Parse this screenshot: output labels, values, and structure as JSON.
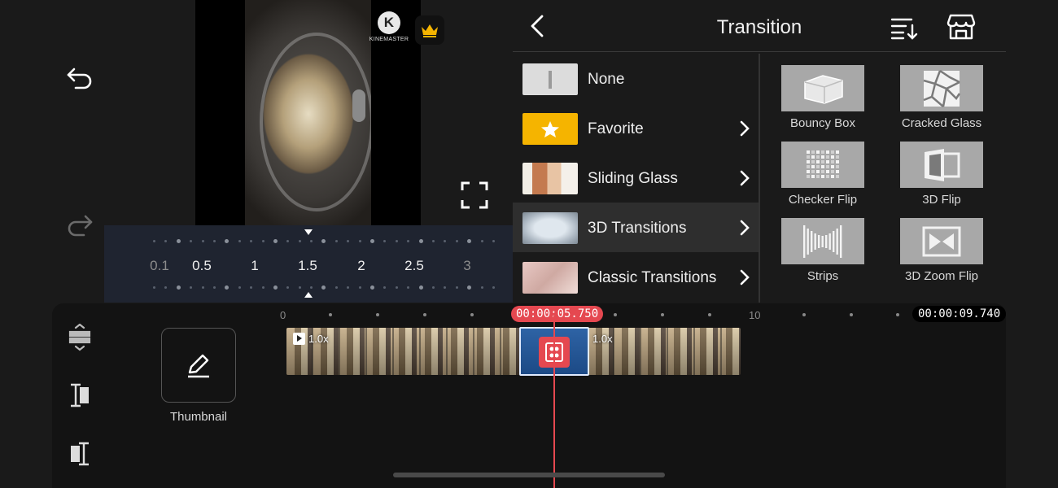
{
  "preview": {
    "watermark_text": "KINEMASTER",
    "watermark_letter": "K"
  },
  "speed": {
    "labels": [
      "0.1",
      "0.5",
      "1",
      "1.5",
      "2",
      "2.5",
      "3"
    ],
    "selected": "1.5"
  },
  "panel": {
    "title": "Transition",
    "categories": [
      {
        "label": "None",
        "has_arrow": false
      },
      {
        "label": "Favorite",
        "has_arrow": true
      },
      {
        "label": "Sliding Glass",
        "has_arrow": true
      },
      {
        "label": "3D Transitions",
        "has_arrow": true,
        "selected": true
      },
      {
        "label": "Classic Transitions",
        "has_arrow": true
      }
    ],
    "effects": [
      {
        "label": "Bouncy Box",
        "icon": "cube-icon"
      },
      {
        "label": "Cracked Glass",
        "icon": "cracked-glass-icon"
      },
      {
        "label": "Checker Flip",
        "icon": "checker-icon"
      },
      {
        "label": "3D Flip",
        "icon": "flip-icon"
      },
      {
        "label": "Strips",
        "icon": "strips-icon"
      },
      {
        "label": "3D Zoom Flip",
        "icon": "zoom-flip-icon"
      }
    ]
  },
  "timeline": {
    "ruler_start": "0",
    "ruler_mid": "10",
    "current_time": "00:00:05.750",
    "total_time": "00:00:09.740",
    "thumbnail_label": "Thumbnail",
    "clip_a_speed": "1.0x",
    "clip_b_speed": "1.0x"
  },
  "colors": {
    "accent_red": "#e54850",
    "favorite_yellow": "#f5b400",
    "transition_blue": "#2e63a5"
  }
}
